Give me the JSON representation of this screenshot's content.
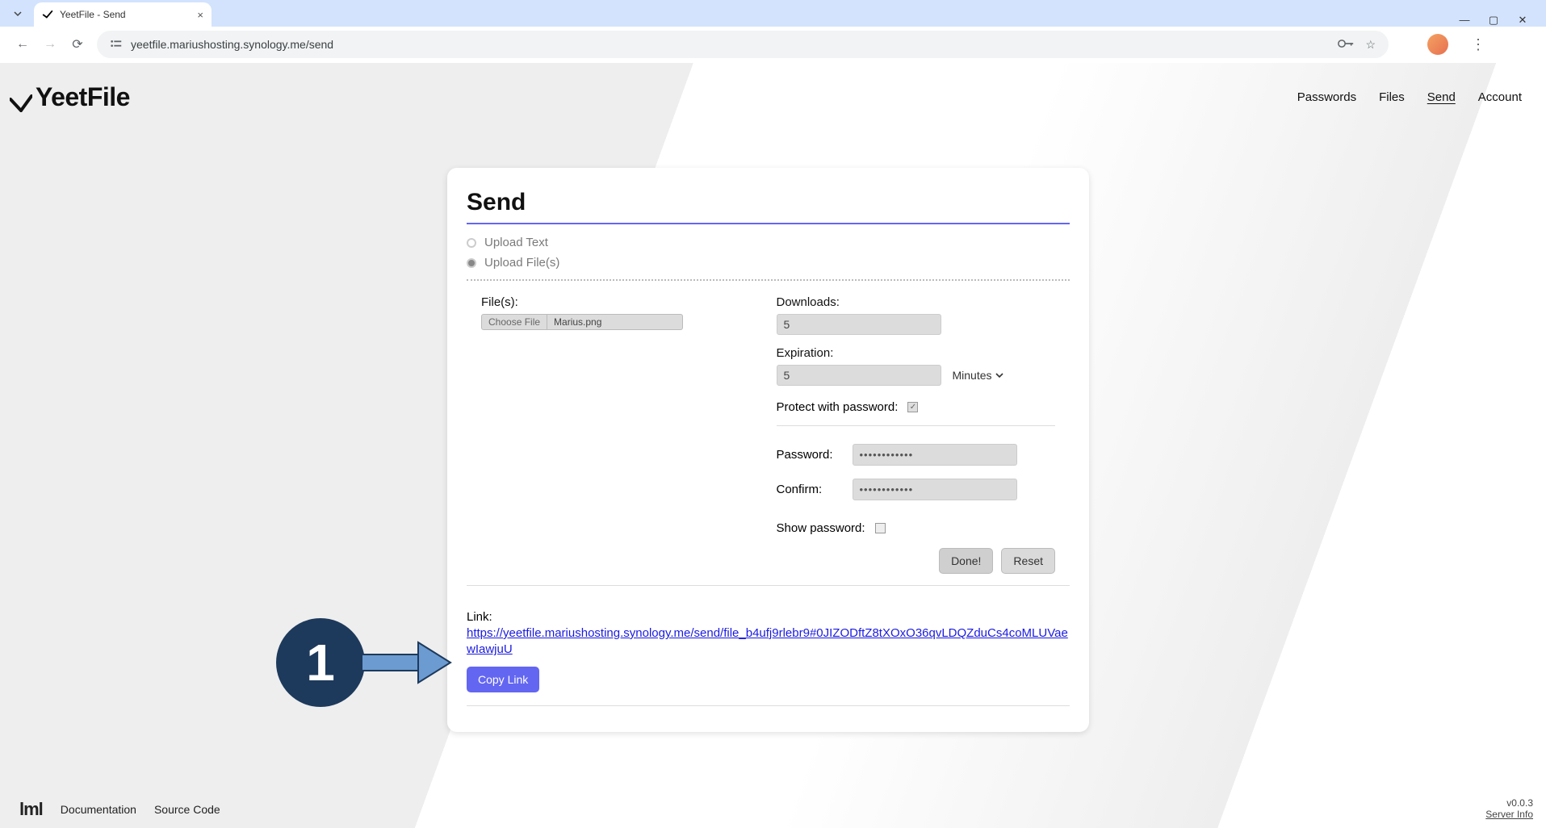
{
  "browser": {
    "tab_title": "YeetFile - Send",
    "url": "yeetfile.mariushosting.synology.me/send"
  },
  "header": {
    "logo_text": "YeetFile",
    "nav": {
      "passwords": "Passwords",
      "files": "Files",
      "send": "Send",
      "account": "Account"
    }
  },
  "card": {
    "title": "Send",
    "radio_text": "Upload Text",
    "radio_files": "Upload File(s)",
    "files_label": "File(s):",
    "choose_file_label": "Choose File",
    "chosen_file_name": "Marius.png",
    "downloads_label": "Downloads:",
    "downloads_value": "5",
    "expiration_label": "Expiration:",
    "expiration_value": "5",
    "expiration_unit": "Minutes",
    "protect_label": "Protect with password:",
    "password_label": "Password:",
    "confirm_label": "Confirm:",
    "password_mask": "••••••••••••",
    "show_password_label": "Show password:",
    "done_label": "Done!",
    "reset_label": "Reset",
    "link_label": "Link:",
    "link_url": "https://yeetfile.mariushosting.synology.me/send/file_b4ufj9rlebr9#0JIZODftZ8tXOxO36qvLDQZduCs4coMLUVaewIawjuU",
    "copy_label": "Copy Link"
  },
  "annotation": {
    "number": "1"
  },
  "footer": {
    "left_logo": "lml",
    "documentation": "Documentation",
    "source_code": "Source Code",
    "version": "v0.0.3",
    "server_info": "Server Info"
  }
}
